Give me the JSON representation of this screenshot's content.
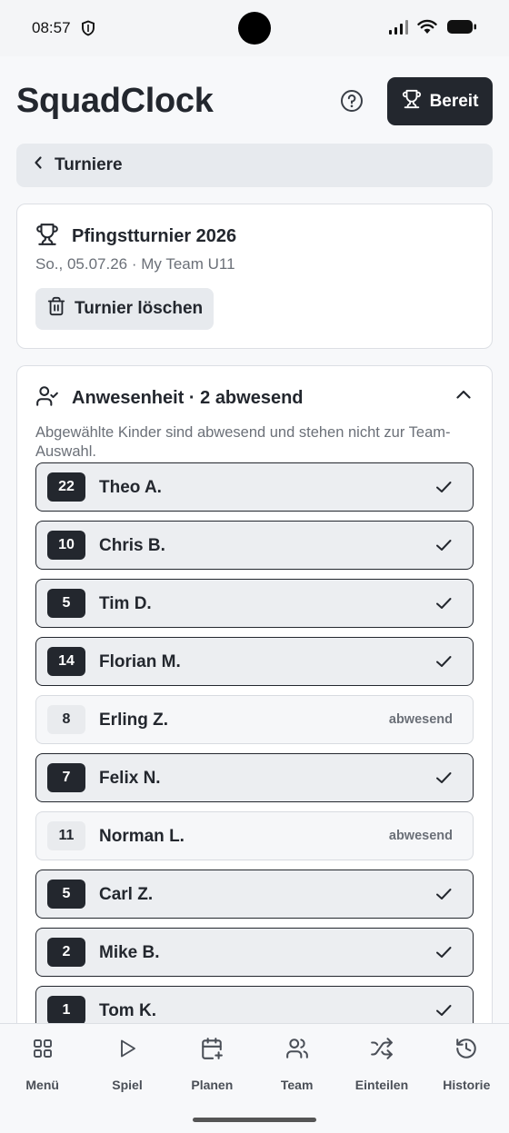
{
  "status_bar": {
    "time": "08:57"
  },
  "header": {
    "title": "SquadClock",
    "ready_label": "Bereit"
  },
  "back_bar": {
    "label": "Turniere"
  },
  "tournament": {
    "title": "Pfingstturnier 2026",
    "subtitle": "So., 05.07.26 · My Team U11",
    "delete_label": "Turnier löschen"
  },
  "attendance": {
    "title": "Anwesenheit · 2 abwesend",
    "description": "Abgewählte Kinder sind abwesend und stehen nicht zur Team-Auswahl.",
    "absent_label": "abwesend",
    "players": [
      {
        "number": "22",
        "name": "Theo A.",
        "present": true
      },
      {
        "number": "10",
        "name": "Chris B.",
        "present": true
      },
      {
        "number": "5",
        "name": "Tim D.",
        "present": true
      },
      {
        "number": "14",
        "name": "Florian M.",
        "present": true
      },
      {
        "number": "8",
        "name": "Erling Z.",
        "present": false
      },
      {
        "number": "7",
        "name": "Felix N.",
        "present": true
      },
      {
        "number": "11",
        "name": "Norman L.",
        "present": false
      },
      {
        "number": "5",
        "name": "Carl Z.",
        "present": true
      },
      {
        "number": "2",
        "name": "Mike B.",
        "present": true
      },
      {
        "number": "1",
        "name": "Tom K.",
        "present": true
      }
    ]
  },
  "nav": {
    "items": [
      {
        "label": "Menü",
        "icon": "grid-icon"
      },
      {
        "label": "Spiel",
        "icon": "play-icon"
      },
      {
        "label": "Planen",
        "icon": "calendar-plus-icon"
      },
      {
        "label": "Team",
        "icon": "users-icon"
      },
      {
        "label": "Einteilen",
        "icon": "shuffle-icon"
      },
      {
        "label": "Historie",
        "icon": "history-icon"
      }
    ]
  }
}
